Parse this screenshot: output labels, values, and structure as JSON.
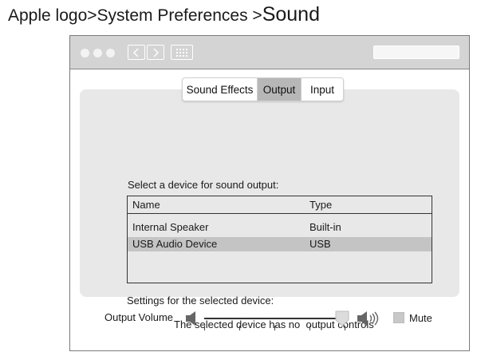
{
  "breadcrumb": {
    "item1": "Apple logo",
    "sep1": ">",
    "item2": "System Preferences ",
    "sep2": ">",
    "item3": "Sound"
  },
  "tabs": [
    "Sound Effects",
    "Output",
    "Input"
  ],
  "selected_tab": "Output",
  "output": {
    "select_label": "Select a device for sound output:",
    "columns": [
      "Name",
      "Type"
    ],
    "devices": [
      {
        "name": "Internal Speaker",
        "type": "Built-in"
      },
      {
        "name": "USB Audio Device",
        "type": "USB"
      }
    ],
    "selected_device": "USB Audio Device",
    "settings_label": "Settings for the selected device:",
    "no_controls_text": "The selected device has no  output controls"
  },
  "volume": {
    "label": "Output Volume",
    "level": 0.95,
    "mute_label": "Mute",
    "muted": false
  },
  "icons": [
    "window-dot-icon",
    "back-chevron-icon",
    "forward-chevron-icon",
    "show-all-grid-icon",
    "speaker-quiet-icon",
    "speaker-loud-icon"
  ]
}
